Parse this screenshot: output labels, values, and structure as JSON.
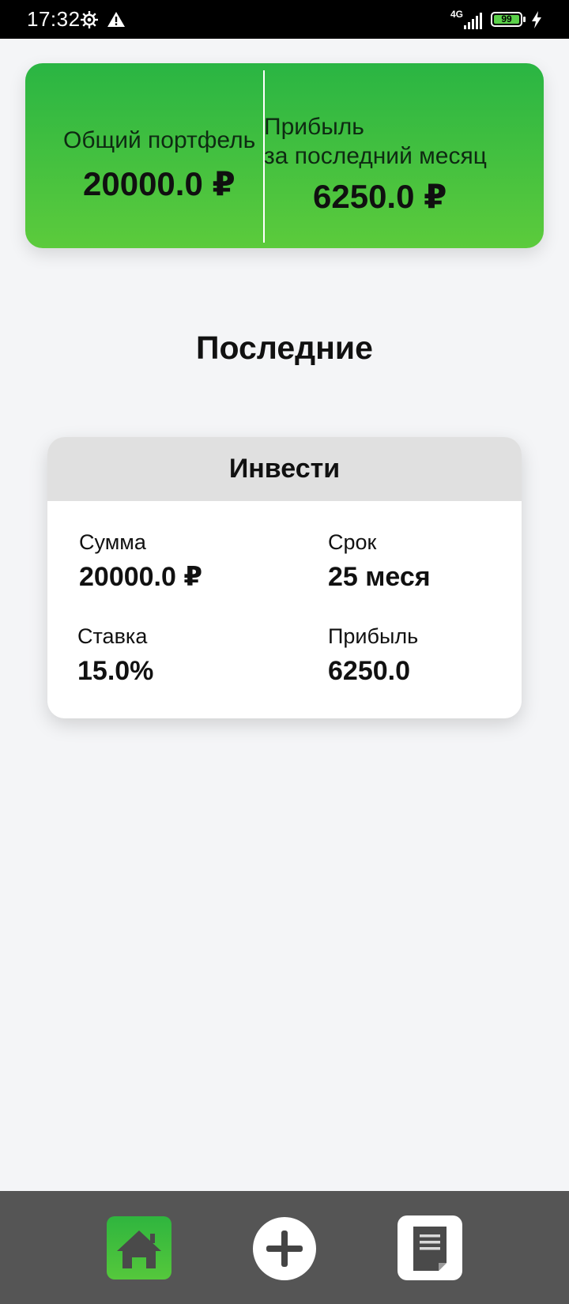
{
  "status_bar": {
    "time": "17:32",
    "network": "4G",
    "battery": "99",
    "icons": [
      "settings-gear-icon",
      "alert-triangle-icon",
      "signal-icon",
      "battery-icon",
      "charging-bolt-icon"
    ]
  },
  "summary": {
    "portfolio_label": "Общий портфель",
    "portfolio_value": "20000.0 ₽",
    "profit_label_line1": "Прибыль",
    "profit_label_line2": "за последний месяц",
    "profit_value": "6250.0 ₽",
    "gradient_colors": [
      "#2ab543",
      "#5ccb3c"
    ]
  },
  "section": {
    "title": "Последние"
  },
  "investment": {
    "title": "Инвести",
    "amount_label": "Сумма",
    "amount_value": "20000.0 ₽",
    "term_label": "Срок",
    "term_value": "25 меся",
    "rate_label": "Ставка",
    "rate_value": "15.0%",
    "profit_label": "Прибыль",
    "profit_value": "6250.0"
  },
  "bottom_nav": {
    "items": [
      {
        "icon": "home-icon",
        "active": true,
        "accent": "#3dbd3d"
      },
      {
        "icon": "plus-icon",
        "active": false
      },
      {
        "icon": "document-icon",
        "active": false
      }
    ],
    "background": "#555555"
  }
}
